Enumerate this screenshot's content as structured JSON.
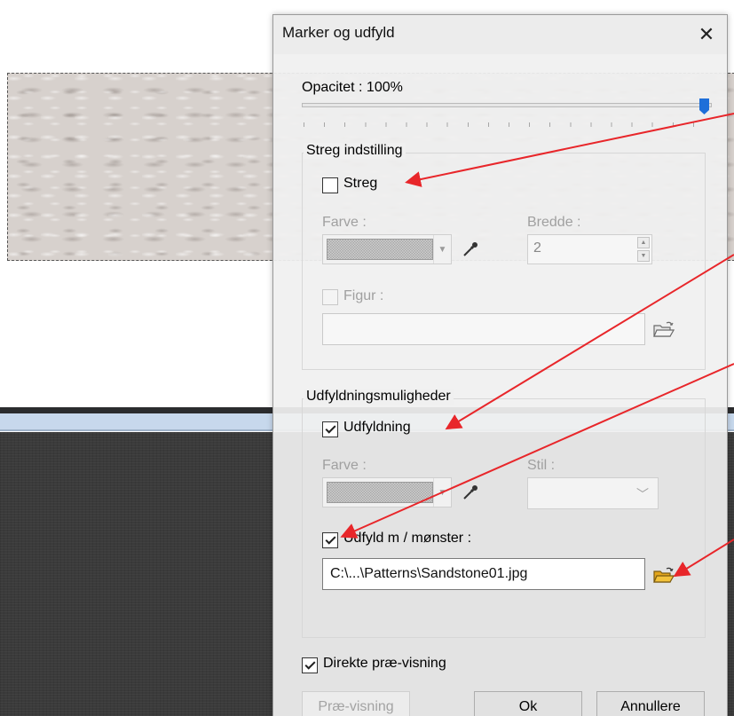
{
  "dialog": {
    "title": "Marker og udfyld",
    "close_glyph": "✕"
  },
  "opacity": {
    "label": "Opacitet : 100%",
    "value_percent": 100
  },
  "stroke_group": {
    "title": "Streg indstilling",
    "stroke_checkbox": {
      "label": "Streg",
      "checked": false
    },
    "color_label": "Farve :",
    "width_label": "Bredde :",
    "width_value": "2",
    "figure_checkbox": {
      "label": "Figur :",
      "checked": false,
      "enabled": false
    },
    "figure_path": ""
  },
  "fill_group": {
    "title": "Udfyldningsmuligheder",
    "fill_checkbox": {
      "label": "Udfyldning",
      "checked": true
    },
    "color_label": "Farve :",
    "style_label": "Stil :",
    "style_value": "",
    "pattern_checkbox": {
      "label": "Udfyld m / mønster :",
      "checked": true
    },
    "pattern_path": "C:\\...\\Patterns\\Sandstone01.jpg"
  },
  "live_preview": {
    "label": "Direkte præ-visning",
    "checked": true
  },
  "buttons": {
    "preview": "Præ-visning",
    "ok": "Ok",
    "cancel": "Annullere"
  },
  "icons": {
    "eyedropper": "eyedropper-icon",
    "folder_open": "folder-open-icon",
    "close": "close-icon"
  },
  "colors": {
    "slider_thumb": "#1e6fd9",
    "annotation_arrow": "#e8262a",
    "folder_active": "#f3c23a"
  }
}
